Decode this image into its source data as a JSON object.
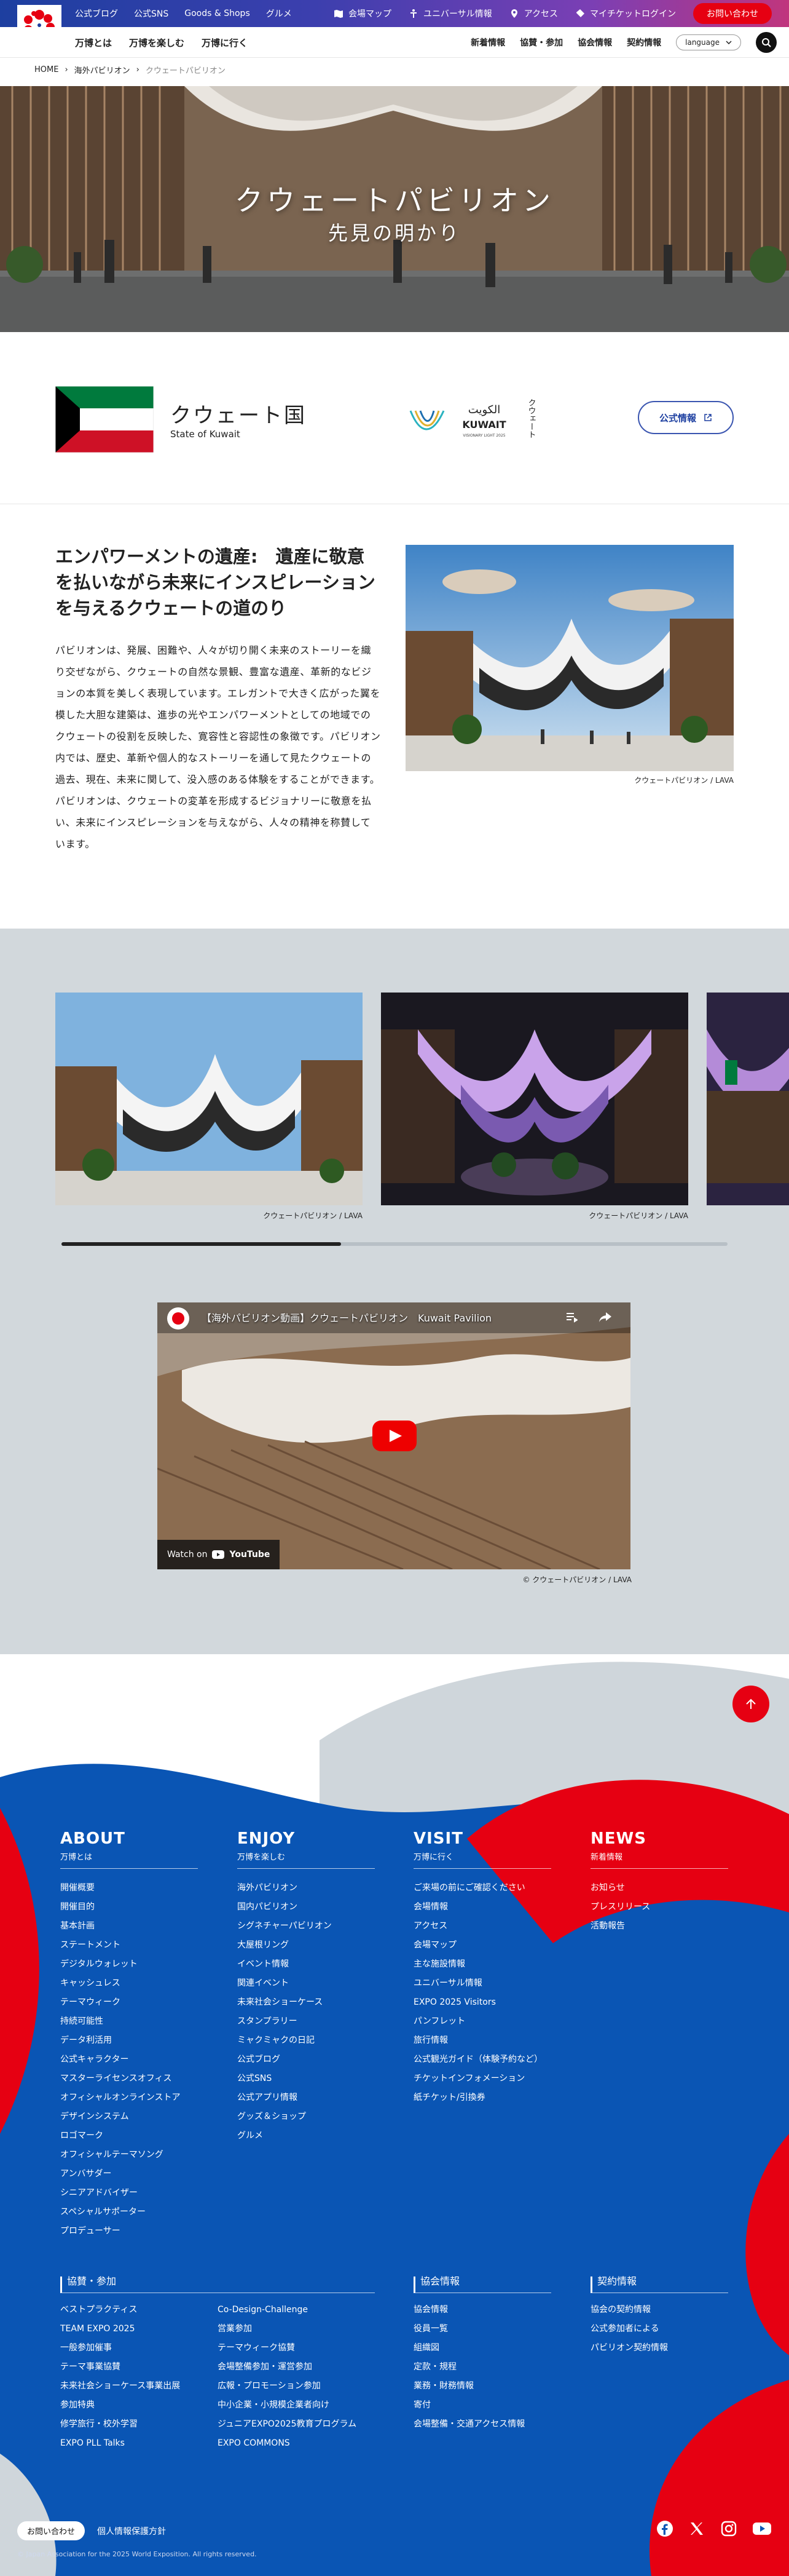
{
  "topbar": {
    "links": [
      "公式ブログ",
      "公式SNS",
      "Goods & Shops",
      "グルメ"
    ],
    "right": [
      "会場マップ",
      "ユニバーサル情報",
      "アクセス",
      "マイチケットログイン"
    ],
    "contact": "お問い合わせ"
  },
  "logo": {
    "text": "EXPO 2025"
  },
  "nav": {
    "left": [
      "万博とは",
      "万博を楽しむ",
      "万博に行く"
    ],
    "right": [
      "新着情報",
      "協賛・参加",
      "協会情報",
      "契約情報"
    ],
    "language": "language"
  },
  "breadcrumb": [
    "HOME",
    "海外パビリオン",
    "クウェートパビリオン"
  ],
  "hero": {
    "title": "クウェートパビリオン",
    "subtitle": "先見の明かり"
  },
  "country": {
    "name_ja": "クウェート国",
    "name_en": "State of Kuwait",
    "logo_arabic": "الكويت",
    "logo_en": "KUWAIT",
    "logo_tagline": "VISIONARY LIGHT 2025",
    "logo_ja": "クウェート",
    "official_label": "公式情報"
  },
  "intro": {
    "title": "エンパワーメントの遺産:　遺産に敬意を払いながら未来にインスピレーションを与えるクウェートの道のり",
    "body": "パビリオンは、発展、困難や、人々が切り開く未来のストーリーを織り交ぜながら、クウェートの自然な景観、豊富な遺産、革新的なビジョンの本質を美しく表現しています。エレガントで大きく広がった翼を模した大胆な建築は、進歩の光やエンパワーメントとしての地域でのクウェートの役割を反映した、寛容性と容認性の象徴です。パビリオン内では、歴史、革新や個人的なストーリーを通して見たクウェートの過去、現在、未来に関して、没入感のある体験をすることができます。パビリオンは、クウェートの変革を形成するビジョナリーに敬意を払い、未来にインスピレーションを与えながら、人々の精神を称賛しています。",
    "caption": "クウェートパビリオン / LAVA"
  },
  "gallery": {
    "captions": [
      "クウェートパビリオン / LAVA",
      "クウェートパビリオン / LAVA"
    ],
    "scroll_fraction": 0.42
  },
  "video": {
    "title": "【海外パビリオン動画】クウェートパビリオン　Kuwait Pavilion",
    "watch_label": "Watch on",
    "watch_brand": "YouTube",
    "caption": "© クウェートパビリオン / LAVA"
  },
  "footer": {
    "columns": [
      {
        "title": "ABOUT",
        "sub": "万博とは",
        "items": [
          "開催概要",
          "開催目的",
          "基本計画",
          "ステートメント",
          "デジタルウォレット",
          "キャッシュレス",
          "テーマウィーク",
          "持続可能性",
          "データ利活用",
          "公式キャラクター",
          "マスターライセンスオフィス",
          "オフィシャルオンラインストア",
          "デザインシステム",
          "ロゴマーク",
          "オフィシャルテーマソング",
          "アンバサダー",
          "シニアアドバイザー",
          "スペシャルサポーター",
          "プロデューサー"
        ]
      },
      {
        "title": "ENJOY",
        "sub": "万博を楽しむ",
        "items": [
          "海外パビリオン",
          "国内パビリオン",
          "シグネチャーパビリオン",
          "大屋根リング",
          "イベント情報",
          "関連イベント",
          "未来社会ショーケース",
          "スタンプラリー",
          "ミャクミャクの日記",
          "公式ブログ",
          "公式SNS",
          "公式アプリ情報",
          "グッズ＆ショップ",
          "グルメ"
        ]
      },
      {
        "title": "VISIT",
        "sub": "万博に行く",
        "items": [
          "ご来場の前にご確認ください",
          "会場情報",
          "アクセス",
          "会場マップ",
          "主な施設情報",
          "ユニバーサル情報",
          "EXPO 2025 Visitors",
          "パンフレット",
          "旅行情報",
          "公式観光ガイド（体験予約など）",
          "チケットインフォメーション",
          "紙チケット/引換券"
        ]
      },
      {
        "title": "NEWS",
        "sub": "新着情報",
        "items": [
          "お知らせ",
          "プレスリリース",
          "活動報告"
        ]
      }
    ],
    "sections": [
      {
        "title": "協賛・参加",
        "items_a": [
          "ベストプラクティス",
          "TEAM EXPO 2025",
          "一般参加催事",
          "テーマ事業協賛",
          "未来社会ショーケース事業出展",
          "参加特典",
          "修学旅行・校外学習",
          "EXPO PLL Talks"
        ],
        "items_b": [
          "Co-Design-Challenge",
          "営業参加",
          "テーマウィーク協賛",
          "会場整備参加・運営参加",
          "広報・プロモーション参加",
          "中小企業・小規模企業者向け",
          "ジュニアEXPO2025教育プログラム",
          "EXPO COMMONS"
        ]
      },
      {
        "title": "協会情報",
        "items": [
          "協会情報",
          "役員一覧",
          "組織図",
          "定款・規程",
          "業務・財務情報",
          "寄付",
          "会場整備・交通アクセス情報"
        ]
      },
      {
        "title": "契約情報",
        "items": [
          "協会の契約情報",
          "公式参加者による",
          "パビリオン契約情報"
        ]
      }
    ],
    "bottom": {
      "contact": "お問い合わせ",
      "privacy": "個人情報保護方針",
      "copyright": "Japan Association for the 2025 World Exposition. All rights reserved."
    },
    "social": [
      "facebook-icon",
      "x-icon",
      "instagram-icon",
      "youtube-icon"
    ]
  }
}
